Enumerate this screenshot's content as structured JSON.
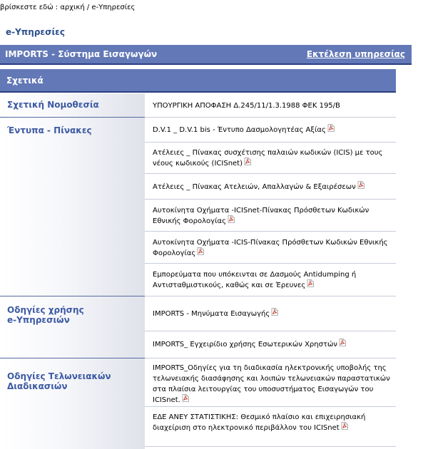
{
  "breadcrumb": {
    "prefix": "βρίσκεστε εδώ :",
    "path": "αρχική / e-Υπηρεσίες"
  },
  "page": {
    "title": "e-Υπηρεσίες"
  },
  "service": {
    "name": "IMPORTS - Σύστημα Εισαγωγών",
    "execute_link": "Εκτέλεση υπηρεσίας"
  },
  "related": {
    "header": "Σχετικά",
    "categories": [
      {
        "label": "Σχετική Νομοθεσία",
        "items": [
          {
            "text": "ΥΠΟΥΡΓΙΚΗ ΑΠΟΦΑΣΗ Δ.245/11/1.3.1988 ΦΕΚ 195/Β",
            "icon": ""
          }
        ]
      },
      {
        "label": "Έντυπα - Πίνακες",
        "items": [
          {
            "text": "D.V.1 _ D.V.1 bis - Έντυπο Δασμολογητέας Αξίας",
            "icon": "pdf-icon"
          },
          {
            "text": "Ατέλειες _ Πίνακας συσχέτισης παλαιών κωδικών (ICIS) με τους νέους κωδικούς (ICISnet)",
            "icon": "pdf-icon"
          },
          {
            "text": "Ατέλειες _ Πίνακας Ατελειών, Απαλλαγών & Εξαιρέσεων",
            "icon": "pdf-icon"
          },
          {
            "text": "Αυτοκίνητα Οχήματα -ICISnet-Πίνακας Πρόσθετων Κωδικών Εθνικής Φορολογίας",
            "icon": "pdf-icon"
          },
          {
            "text": "Αυτοκίνητα Οχήματα -ICIS-Πίνακας Πρόσθετων Κωδικών Εθνικής Φορολογίας",
            "icon": "pdf-icon"
          },
          {
            "text": "Εμπορεύματα που υπόκεινται σε Δασμούς Antidumping ή Αντισταθμιστικούς, καθώς και σε Έρευνες",
            "icon": "pdf-icon"
          }
        ]
      },
      {
        "label": "Οδηγίες χρήσης e-Υπηρεσιών",
        "items": [
          {
            "text": "IMPORTS - Μηνύματα Εισαγωγής",
            "icon": "pdf-icon"
          },
          {
            "text": "IMPORTS_ Εγχειρίδιο χρήσης Εσωτερικών Χρηστών",
            "icon": "pdf-icon"
          }
        ]
      },
      {
        "label": "Οδηγίες Τελωνειακών Διαδικασιών",
        "items": [
          {
            "text": "IMPORTS_Οδηγίες για τη διαδικασία ηλεκτρονικής υποβολής της τελωνειακής διασάφησης και λοιπών τελωνειακών παραστατικών στα πλαίσια λειτουργίας του υποσυστήματος Εισαγωγών του ICISnet.",
            "icon": "pdf-icon"
          },
          {
            "text": "ΕΔΕ ΑΝΕΥ ΣΤΑΤΙΣΤΙΚΗΣ: Θεσμικό πλαίσιο και επιχειρησιακή διαχείριση στο ηλεκτρονικό περιβάλλον του ICISnet",
            "icon": "pdf-icon"
          }
        ]
      }
    ]
  },
  "colors": {
    "bar": "#6278b7",
    "bar_border": "#2b3f80",
    "category_text": "#3d5aa3",
    "title_text": "#2d4f8c",
    "pdf_icon": "#c0392b"
  }
}
